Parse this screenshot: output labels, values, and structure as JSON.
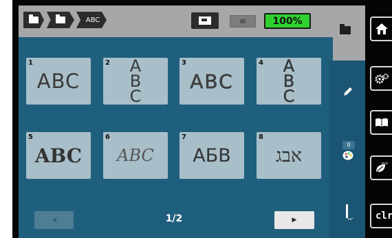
{
  "breadcrumb": {
    "items": [
      {
        "icon": "folder-icon"
      },
      {
        "icon": "folder-open-icon"
      },
      {
        "label": "ABC"
      }
    ]
  },
  "status": {
    "tool_icon": "sewing-foot-icon",
    "spool_icon": "bobbin-icon",
    "zoom_label": "100%",
    "zoom_color": "#2fd12f"
  },
  "tiles": [
    {
      "number": "1",
      "text": "ABC",
      "style": "block"
    },
    {
      "number": "2",
      "letters": [
        "A",
        "B",
        "C"
      ],
      "style": "vertical"
    },
    {
      "number": "3",
      "text": "ABC",
      "style": "block-outline"
    },
    {
      "number": "4",
      "letters": [
        "A",
        "B",
        "C"
      ],
      "style": "vertical-outline"
    },
    {
      "number": "5",
      "text": "ABC",
      "style": "gothic"
    },
    {
      "number": "6",
      "text": "ABC",
      "style": "script"
    },
    {
      "number": "7",
      "text": "АБВ",
      "style": "cyrillic"
    },
    {
      "number": "8",
      "text": "אבג",
      "style": "hebrew"
    }
  ],
  "pager": {
    "label": "1/2"
  },
  "side_panel": {
    "counter": "0"
  },
  "right_buttons": {
    "clr_label": "clr"
  }
}
